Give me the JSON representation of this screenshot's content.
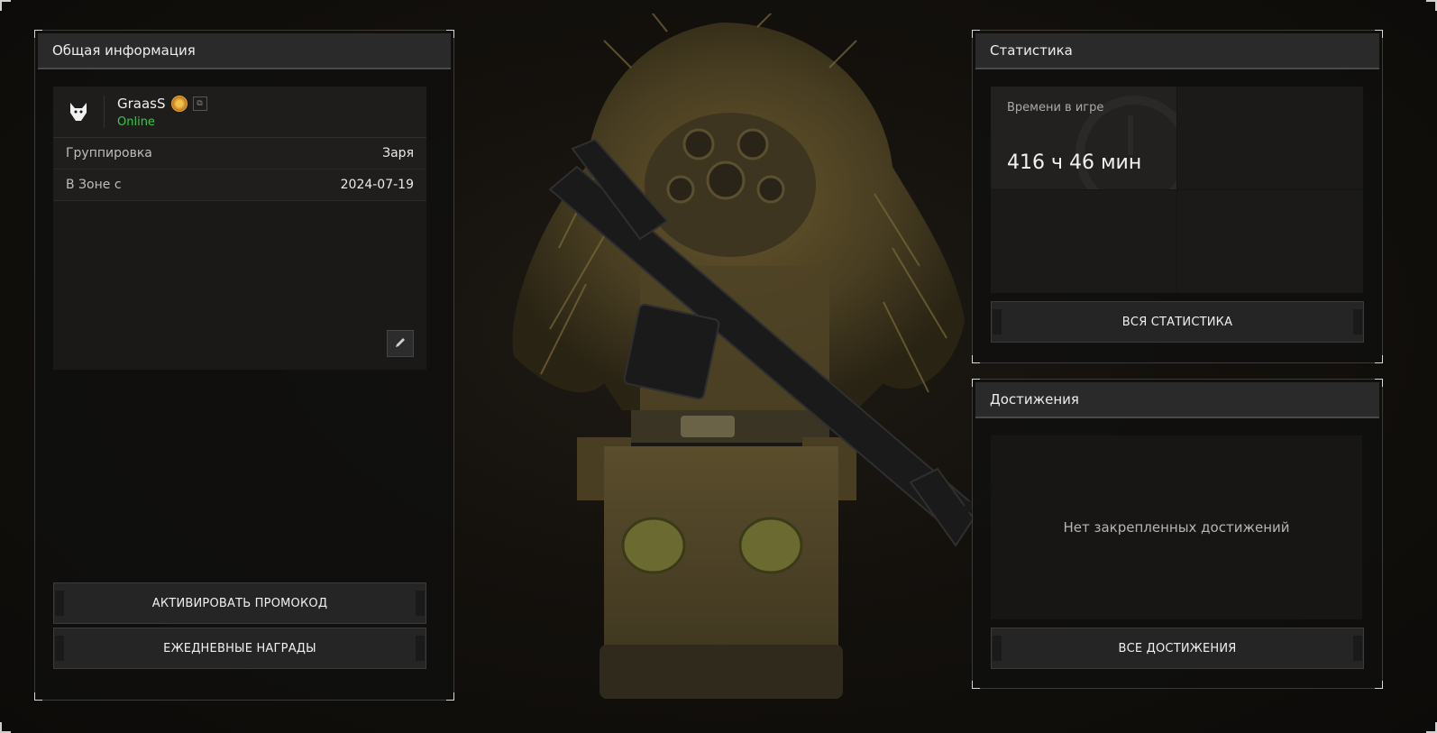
{
  "left_panel": {
    "title": "Общая информация",
    "user": {
      "name": "GraasS",
      "status": "Online"
    },
    "rows": [
      {
        "key": "Группировка",
        "value": "Заря"
      },
      {
        "key": "В Зоне с",
        "value": "2024-07-19"
      }
    ],
    "buttons": {
      "promo": "АКТИВИРОВАТЬ ПРОМОКОД",
      "daily": "ЕЖЕДНЕВНЫЕ НАГРАДЫ"
    }
  },
  "stats_panel": {
    "title": "Статистика",
    "playtime_label": "Времени в игре",
    "playtime_value": "416 ч 46 мин",
    "button": "ВСЯ СТАТИСТИКА"
  },
  "achievements_panel": {
    "title": "Достижения",
    "empty_text": "Нет закрепленных достижений",
    "button": "ВСЕ ДОСТИЖЕНИЯ"
  },
  "colors": {
    "online": "#37c94a",
    "panel_header": "#2a2a2a",
    "background": "#14110d"
  },
  "icons": {
    "avatar": "wolf-head-icon",
    "badge": "faction-badge-icon",
    "copy": "copy-icon",
    "edit": "pencil-icon"
  }
}
